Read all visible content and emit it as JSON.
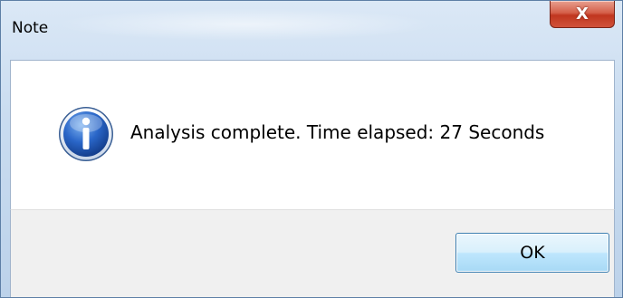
{
  "window": {
    "title": "Note",
    "close_glyph": "X"
  },
  "dialog": {
    "icon": "info-icon",
    "message": "Analysis complete. Time elapsed: 27 Seconds",
    "ok_label": "OK"
  },
  "colors": {
    "frame": "#c9dcf0",
    "close_button": "#c0361f",
    "content_bg": "#ffffff",
    "footer_bg": "#f0f0f0",
    "ok_button_border": "#3c7fb1",
    "info_icon_blue": "#1f58b8"
  }
}
